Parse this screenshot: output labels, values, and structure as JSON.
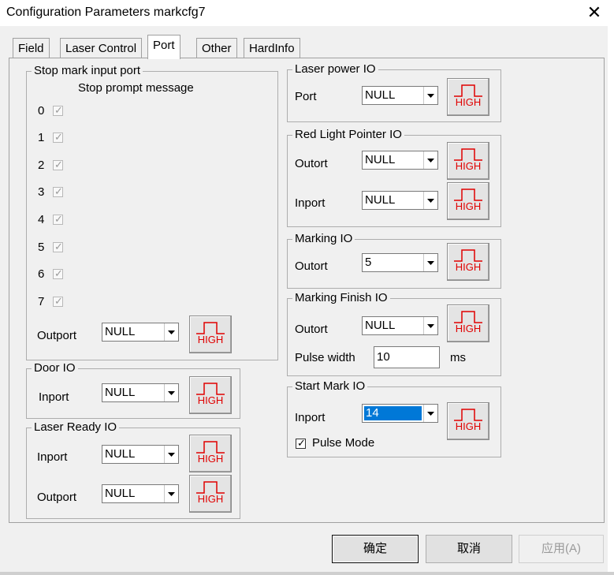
{
  "window": {
    "title": "Configuration Parameters markcfg7",
    "close_icon": "close-icon"
  },
  "tabs": [
    {
      "label": "Field",
      "active": false
    },
    {
      "label": "Laser Control",
      "active": false
    },
    {
      "label": "Port",
      "active": true
    },
    {
      "label": "Other",
      "active": false
    },
    {
      "label": "HardInfo",
      "active": false
    }
  ],
  "stop_mark": {
    "title": "Stop mark input port",
    "subtitle": "Stop prompt message",
    "ports": [
      {
        "label": "0",
        "checked": true
      },
      {
        "label": "1",
        "checked": true
      },
      {
        "label": "2",
        "checked": true
      },
      {
        "label": "3",
        "checked": true
      },
      {
        "label": "4",
        "checked": true
      },
      {
        "label": "5",
        "checked": true
      },
      {
        "label": "6",
        "checked": true
      },
      {
        "label": "7",
        "checked": true
      }
    ],
    "outport_label": "Outport",
    "outport_value": "NULL"
  },
  "door_io": {
    "title": "Door IO",
    "inport_label": "Inport",
    "inport_value": "NULL"
  },
  "laser_ready_io": {
    "title": "Laser Ready IO",
    "inport_label": "Inport",
    "inport_value": "NULL",
    "outport_label": "Outport",
    "outport_value": "NULL"
  },
  "laser_power_io": {
    "title": "Laser power IO",
    "port_label": "Port",
    "port_value": "NULL"
  },
  "red_light_io": {
    "title": "Red Light Pointer IO",
    "outort_label": "Outort",
    "outort_value": "NULL",
    "inport_label": "Inport",
    "inport_value": "NULL"
  },
  "marking_io": {
    "title": "Marking IO",
    "outort_label": "Outort",
    "outort_value": "5"
  },
  "marking_finish_io": {
    "title": "Marking Finish IO",
    "outort_label": "Outort",
    "outort_value": "NULL",
    "pulse_width_label": "Pulse width",
    "pulse_width_value": "10",
    "pulse_width_unit": "ms"
  },
  "start_mark_io": {
    "title": "Start Mark IO",
    "inport_label": "Inport",
    "inport_value": "14",
    "pulse_mode_label": "Pulse Mode",
    "pulse_mode_checked": true
  },
  "level_button_text": "HIGH",
  "level_button_color": "#e00000",
  "buttons": {
    "ok": "确定",
    "cancel": "取消",
    "apply": "应用(A)"
  }
}
